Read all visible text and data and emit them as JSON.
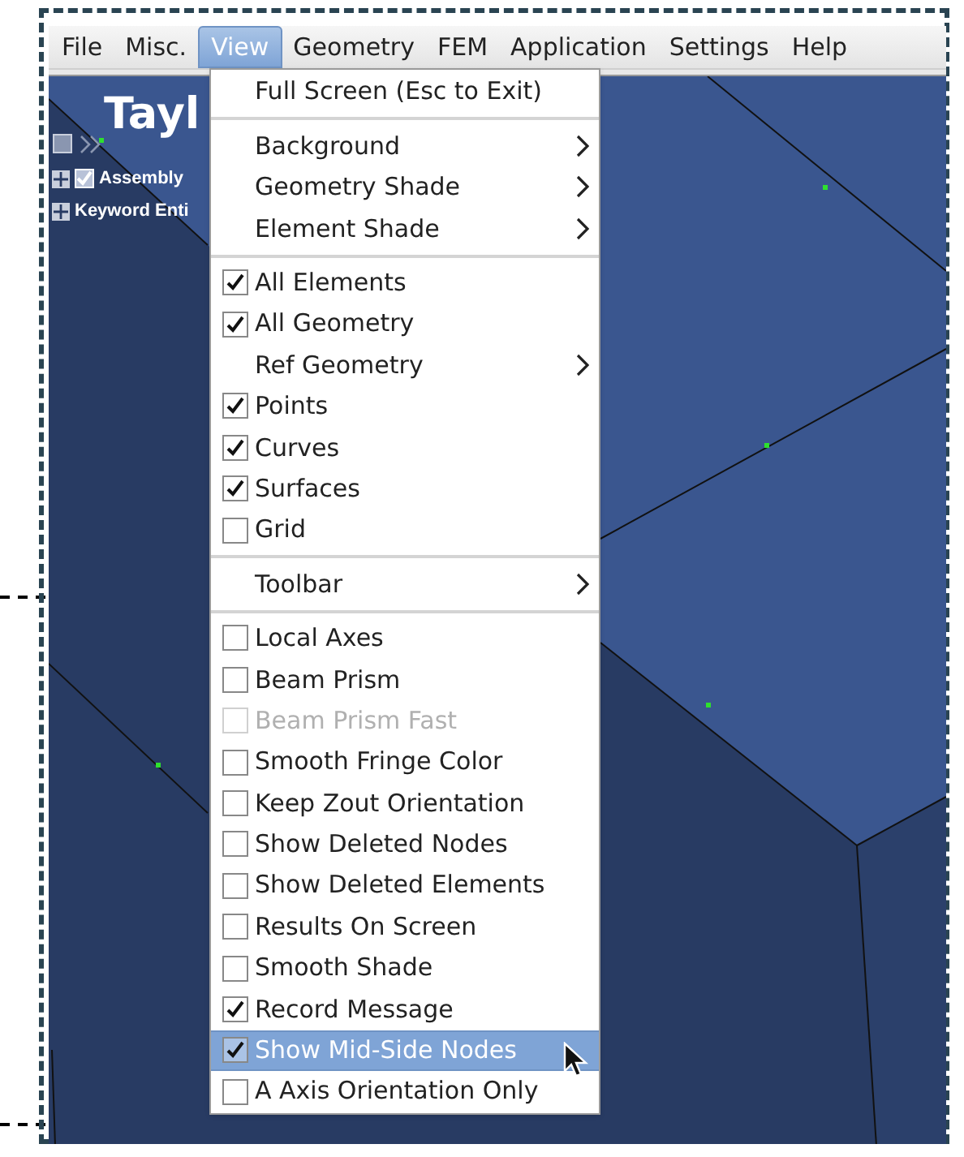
{
  "menu_bar": [
    {
      "label": "File",
      "selected": false
    },
    {
      "label": "Misc.",
      "selected": false
    },
    {
      "label": "View",
      "selected": true
    },
    {
      "label": "Geometry",
      "selected": false
    },
    {
      "label": "FEM",
      "selected": false
    },
    {
      "label": "Application",
      "selected": false
    },
    {
      "label": "Settings",
      "selected": false
    },
    {
      "label": "Help",
      "selected": false
    }
  ],
  "viewport": {
    "title": "Tayl",
    "tree": [
      {
        "label": "Assembly",
        "kind": "check",
        "checked": true
      },
      {
        "label": "Keyword Enti",
        "kind": "plain"
      }
    ]
  },
  "view_menu": {
    "groups": [
      [
        {
          "label": "Full Screen (Esc to Exit)",
          "kind": "action",
          "disabled": false,
          "selected": false
        }
      ],
      [
        {
          "label": "Background",
          "kind": "submenu",
          "disabled": false,
          "selected": false
        },
        {
          "label": "Geometry Shade",
          "kind": "submenu",
          "disabled": false,
          "selected": false
        },
        {
          "label": "Element Shade",
          "kind": "submenu",
          "disabled": false,
          "selected": false
        }
      ],
      [
        {
          "label": "All Elements",
          "kind": "check",
          "checked": true,
          "disabled": false,
          "selected": false
        },
        {
          "label": "All Geometry",
          "kind": "check",
          "checked": true,
          "disabled": false,
          "selected": false
        },
        {
          "label": "Ref Geometry",
          "kind": "submenu",
          "disabled": false,
          "selected": false
        },
        {
          "label": "Points",
          "kind": "check",
          "checked": true,
          "disabled": false,
          "selected": false
        },
        {
          "label": "Curves",
          "kind": "check",
          "checked": true,
          "disabled": false,
          "selected": false
        },
        {
          "label": "Surfaces",
          "kind": "check",
          "checked": true,
          "disabled": false,
          "selected": false
        },
        {
          "label": "Grid",
          "kind": "check",
          "checked": false,
          "disabled": false,
          "selected": false
        }
      ],
      [
        {
          "label": "Toolbar",
          "kind": "submenu",
          "disabled": false,
          "selected": false
        }
      ],
      [
        {
          "label": "Local Axes",
          "kind": "check",
          "checked": false,
          "disabled": false,
          "selected": false
        },
        {
          "label": "Beam Prism",
          "kind": "check",
          "checked": false,
          "disabled": false,
          "selected": false
        },
        {
          "label": "Beam Prism Fast",
          "kind": "check",
          "checked": false,
          "disabled": true,
          "selected": false
        },
        {
          "label": "Smooth Fringe Color",
          "kind": "check",
          "checked": false,
          "disabled": false,
          "selected": false
        },
        {
          "label": "Keep Zout Orientation",
          "kind": "check",
          "checked": false,
          "disabled": false,
          "selected": false
        },
        {
          "label": "Show Deleted Nodes",
          "kind": "check",
          "checked": false,
          "disabled": false,
          "selected": false
        },
        {
          "label": "Show Deleted Elements",
          "kind": "check",
          "checked": false,
          "disabled": false,
          "selected": false
        },
        {
          "label": "Results On Screen",
          "kind": "check",
          "checked": false,
          "disabled": false,
          "selected": false
        },
        {
          "label": "Smooth Shade",
          "kind": "check",
          "checked": false,
          "disabled": false,
          "selected": false
        },
        {
          "label": "Record Message",
          "kind": "check",
          "checked": true,
          "disabled": false,
          "selected": false
        },
        {
          "label": "Show Mid-Side Nodes",
          "kind": "check",
          "checked": true,
          "disabled": false,
          "selected": true
        },
        {
          "label": "A Axis Orientation Only",
          "kind": "check",
          "checked": false,
          "disabled": false,
          "selected": false
        }
      ]
    ]
  }
}
